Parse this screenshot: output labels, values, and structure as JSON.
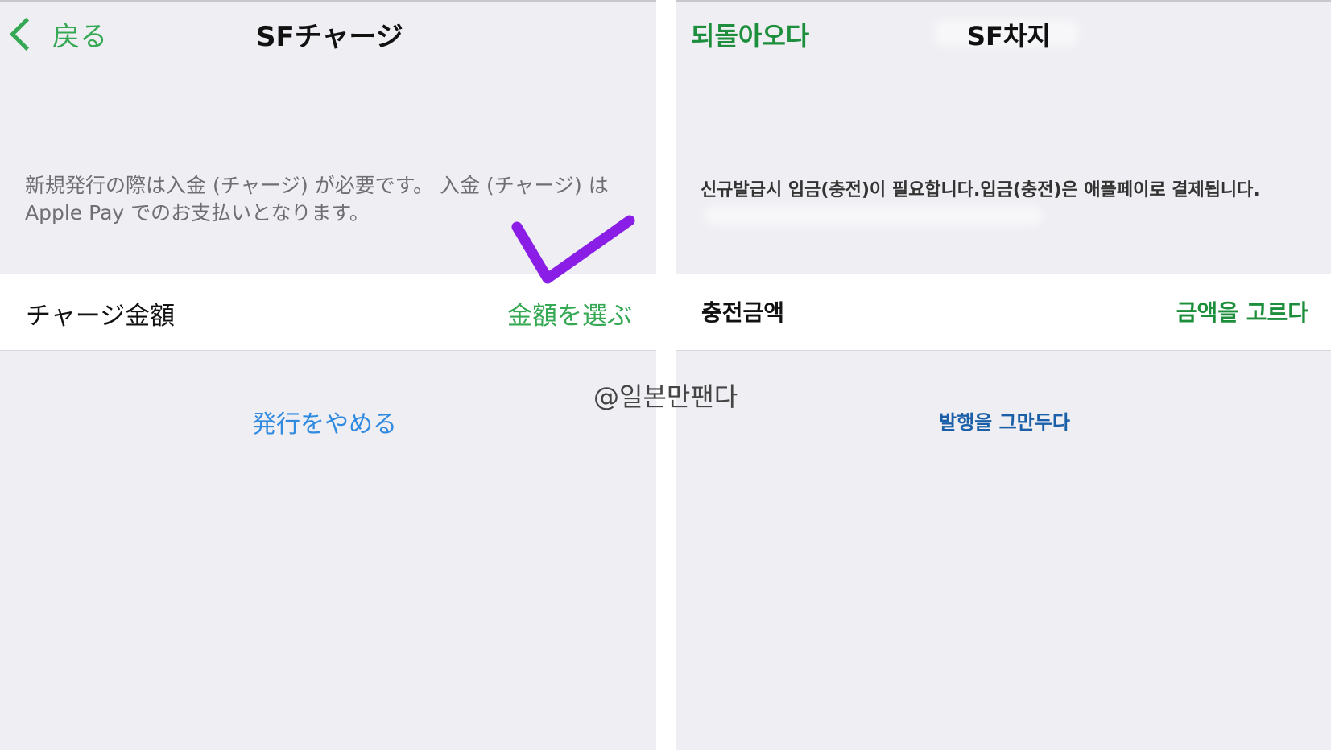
{
  "left_panel": {
    "back_label": "戻る",
    "title": "SFチャージ",
    "description_line1": "新規発行の際は入金 (チャージ) が必要です。 入金 (チャージ) は",
    "description_line2": "Apple Pay でのお支払いとなります。",
    "row_label": "チャージ金額",
    "row_action": "金額を選ぶ",
    "cancel_label": "発行をやめる"
  },
  "right_panel": {
    "back_label": "되돌아오다",
    "title": "SF차지",
    "description": "신규발급시 입금(충전)이 필요합니다.입금(충전)은 애플페이로 결제됩니다.",
    "row_label": "충전금액",
    "row_action": "금액을 고르다",
    "cancel_label": "발행을 그만두다"
  },
  "watermark": "@일본만팬다",
  "colors": {
    "accent_green": "#34a853",
    "accent_green_dark": "#1d8f3c",
    "link_blue": "#2f8ae0",
    "link_blue_dark": "#1a5fa8",
    "checkmark_purple": "#8a1ee6",
    "background": "#eeeef3"
  },
  "icons": {
    "back": "chevron-left-icon",
    "annotation": "checkmark-icon"
  }
}
